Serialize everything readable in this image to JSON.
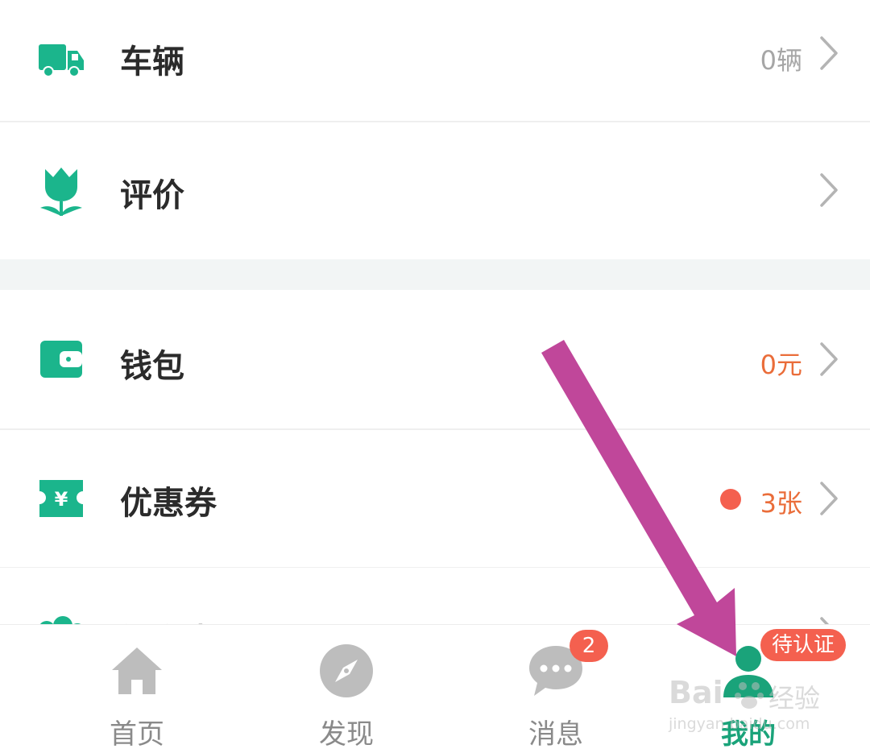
{
  "menu": {
    "vehicles": {
      "label": "车辆",
      "value": "0辆",
      "icon": "truck-icon"
    },
    "reviews": {
      "label": "评价",
      "value": "",
      "icon": "tulip-icon"
    },
    "wallet": {
      "label": "钱包",
      "value": "0元",
      "icon": "wallet-icon"
    },
    "coupons": {
      "label": "优惠券",
      "value": "3张",
      "icon": "coupon-icon",
      "has_dot": true
    },
    "partial": {
      "label": "福利中心",
      "icon": "gift-icon"
    }
  },
  "tabbar": {
    "tabs": [
      {
        "label": "首页",
        "icon": "home-icon"
      },
      {
        "label": "发现",
        "icon": "compass-icon"
      },
      {
        "label": "消息",
        "icon": "chat-icon",
        "badge": "2"
      },
      {
        "label": "我的",
        "icon": "user-icon",
        "badge": "待认证",
        "active": true
      }
    ]
  },
  "watermark": {
    "brand": "Bai",
    "brand_cn": "经验",
    "url": "jingyan.baidu.com"
  },
  "colors": {
    "accent": "#1aa37a",
    "icon_green": "#1bb58c",
    "orange": "#ea6d3a",
    "badge_red": "#f4604f",
    "annotation_arrow": "#c0479a"
  }
}
